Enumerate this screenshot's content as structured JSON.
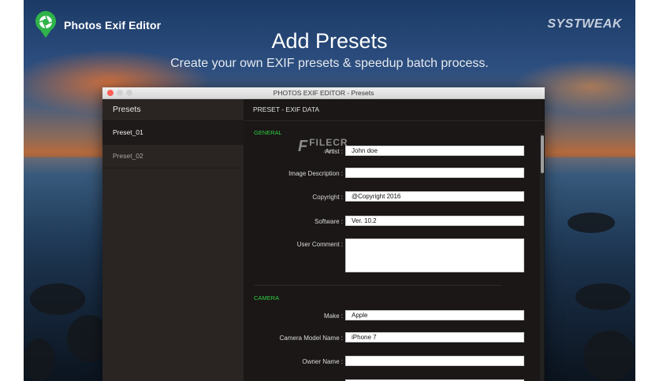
{
  "banner": {
    "logo_text": "Photos Exif Editor",
    "brand": "SYSTWEAK",
    "headline": "Add Presets",
    "subline": "Create your own EXIF presets & speedup batch process."
  },
  "window": {
    "title": "PHOTOS EXIF EDITOR - Presets",
    "sidebar": {
      "header": "Presets",
      "items": [
        {
          "label": "Preset_01",
          "selected": true
        },
        {
          "label": "Preset_02",
          "selected": false
        }
      ]
    },
    "main": {
      "header": "PRESET - EXIF DATA",
      "watermark": {
        "name": "FILECR",
        "sub": ".com"
      },
      "sections": {
        "general": {
          "title": "GENERAL",
          "fields": [
            {
              "label": "Artist :",
              "value": "John doe"
            },
            {
              "label": "Image Description :",
              "value": ""
            },
            {
              "label": "Copyright :",
              "value": "@Copyright 2016"
            },
            {
              "label": "Software :",
              "value": "Ver. 10.2"
            },
            {
              "label": "User Comment :",
              "value": ""
            }
          ]
        },
        "camera": {
          "title": "CAMERA",
          "fields": [
            {
              "label": "Make :",
              "value": "Apple"
            },
            {
              "label": "Camera Model Name :",
              "value": "iPhone 7"
            },
            {
              "label": "Owner Name :",
              "value": ""
            }
          ]
        }
      }
    }
  },
  "colors": {
    "section_title": "#2ecc40",
    "logo_green": "#2fb34a"
  }
}
